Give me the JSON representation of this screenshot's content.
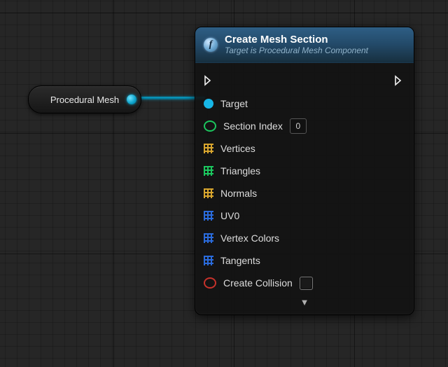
{
  "source_node": {
    "label": "Procedural Mesh"
  },
  "func_node": {
    "icon_letter": "f",
    "title": "Create Mesh Section",
    "subtitle": "Target is Procedural Mesh Component",
    "pins": {
      "target": "Target",
      "section_index": "Section Index",
      "section_index_value": "0",
      "vertices": "Vertices",
      "triangles": "Triangles",
      "normals": "Normals",
      "uv0": "UV0",
      "vertex_colors": "Vertex Colors",
      "tangents": "Tangents",
      "create_collision": "Create Collision"
    },
    "expand_glyph": "▼"
  }
}
